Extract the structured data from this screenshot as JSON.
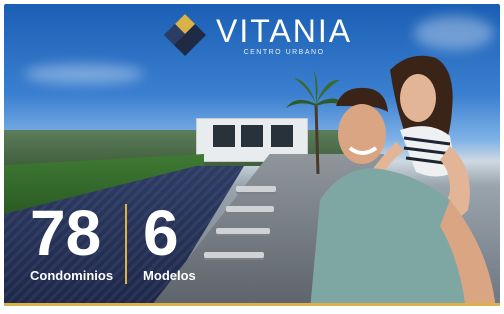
{
  "brand": {
    "name": "VITANIA",
    "tagline": "CENTRO URBANO",
    "colors": {
      "navy": "#1f2a44",
      "gold": "#d9b24a"
    }
  },
  "stats": [
    {
      "number": "78",
      "label": "Condominios"
    },
    {
      "number": "6",
      "label": "Modelos"
    }
  ]
}
